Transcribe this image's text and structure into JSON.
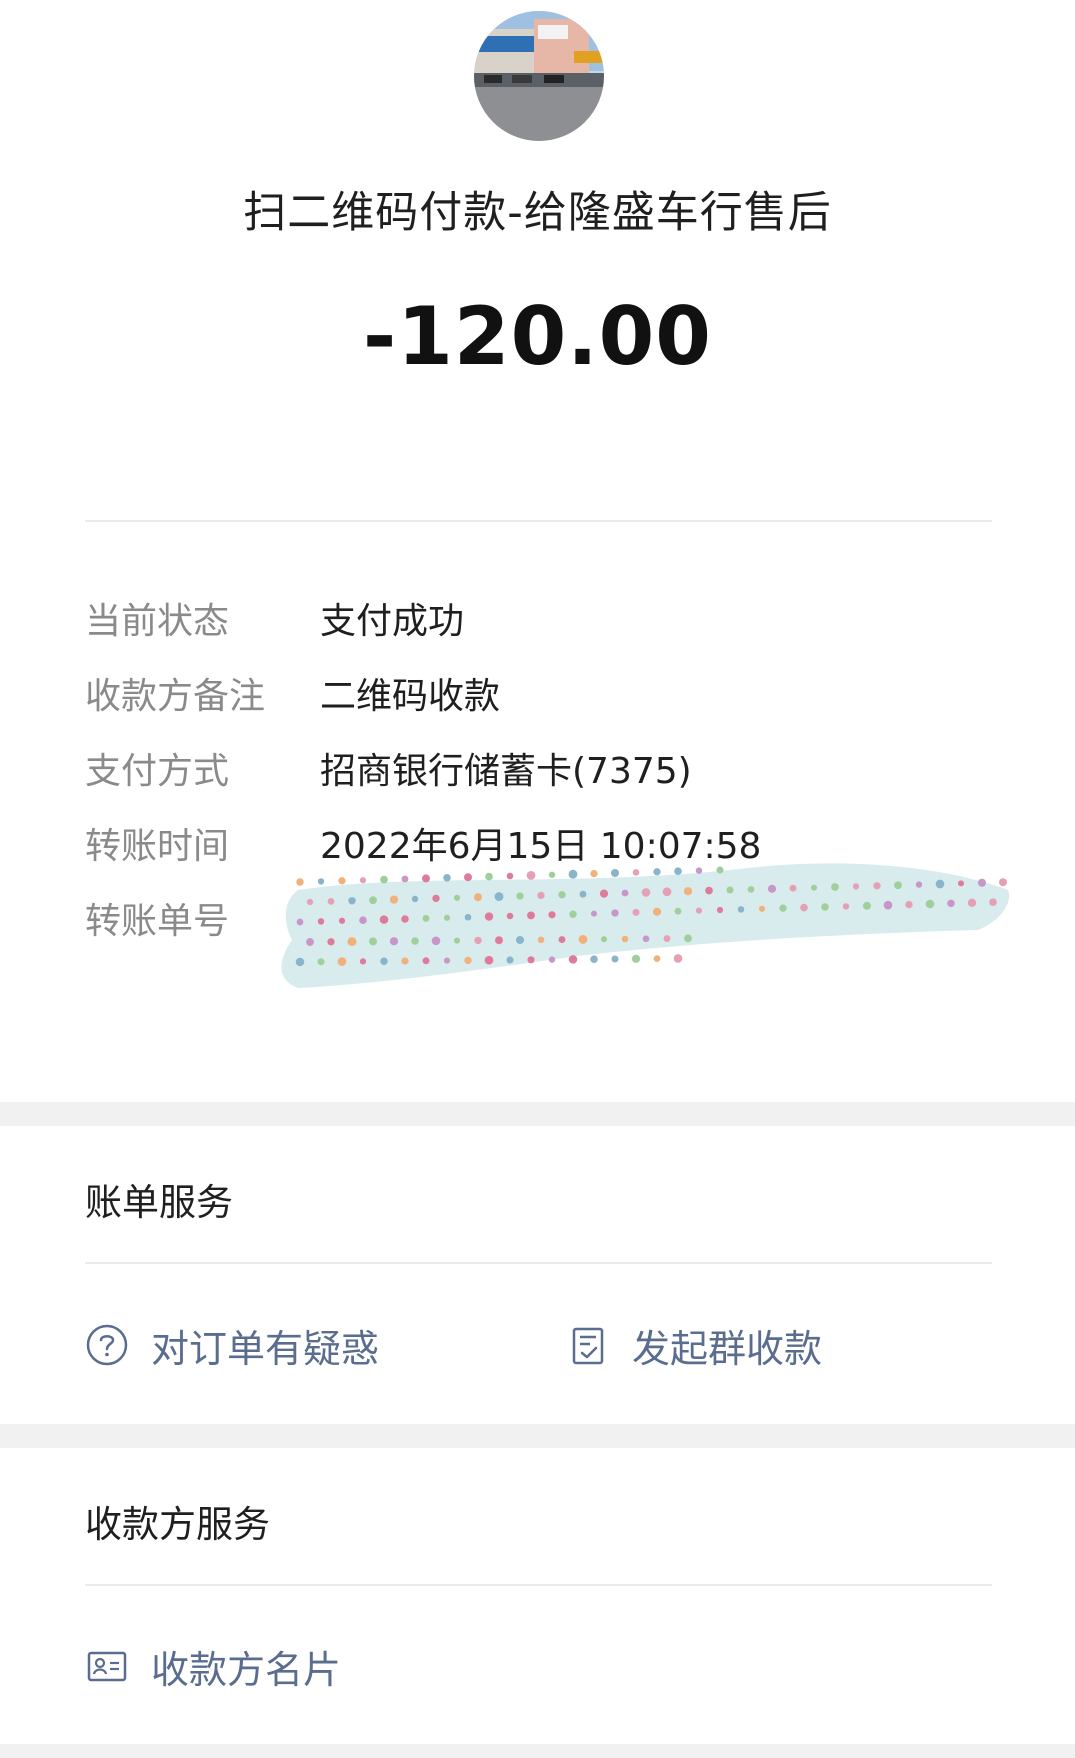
{
  "header": {
    "title": "扫二维码付款-给隆盛车行售后",
    "amount": "-120.00"
  },
  "details": [
    {
      "label": "当前状态",
      "value": "支付成功"
    },
    {
      "label": "收款方备注",
      "value": "二维码收款"
    },
    {
      "label": "支付方式",
      "value": "招商银行储蓄卡(7375)"
    },
    {
      "label": "转账时间",
      "value": "2022年6月15日 10:07:58"
    },
    {
      "label": "转账单号",
      "value": ""
    }
  ],
  "bill_service": {
    "title": "账单服务",
    "doubt_label": "对订单有疑惑",
    "doubt_icon": "question-circle-icon",
    "group_collect_label": "发起群收款",
    "group_collect_icon": "document-check-icon"
  },
  "payee_service": {
    "title": "收款方服务",
    "card_label": "收款方名片",
    "card_icon": "contact-card-icon"
  },
  "colors": {
    "link": "#5a6d8f",
    "label_gray": "#8a8a8a",
    "section_bg": "#f1f1f1",
    "redact_bg": "#d8ecee"
  }
}
